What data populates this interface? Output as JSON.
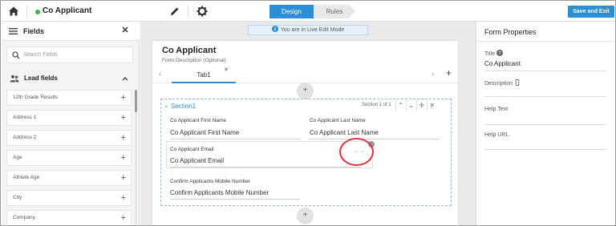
{
  "topbar": {
    "form_name": "Co Applicant",
    "tabs": [
      {
        "label": "Design",
        "active": true
      },
      {
        "label": "Rules",
        "active": false
      }
    ],
    "save_exit_label": "Save and Exit",
    "icons": [
      "home-icon",
      "pencil-icon",
      "gear-icon"
    ],
    "colors": {
      "accent": "#2b8fd6",
      "status": "#3db34a"
    }
  },
  "left_panel": {
    "title": "Fields",
    "search_placeholder": "Search Fields",
    "group_label": "Lead fields",
    "fields": [
      "12th Grade Results",
      "Address 1",
      "Address 2",
      "Age",
      "Athlete Age",
      "City",
      "Company"
    ]
  },
  "center": {
    "live_mode_text": "You are in Live Edit Mode",
    "form_title": "Co Applicant",
    "form_description": "Form Description (Optional)",
    "tab_label": "Tab1",
    "section": {
      "title": "Section1",
      "count_text": "Section 1 of 1",
      "fields": [
        {
          "label": "Co Applicant First Name",
          "value": "Co Applicant First Name"
        },
        {
          "label": "Co Applicant Last Name",
          "value": "Co Applicant Last Name"
        },
        {
          "label": "Co Applicant Email",
          "value": "Co Applicant Email"
        },
        {
          "label": "Confirm Applicants Mobile Number",
          "value": "Confirm Applicants Mobile Number"
        }
      ]
    },
    "highlight_color": "#d9363e"
  },
  "right_panel": {
    "title": "Form Properties",
    "properties": [
      {
        "label": "Title",
        "value": "Co Applicant"
      },
      {
        "label": "Description",
        "value": ""
      },
      {
        "label": "Help Text",
        "value": ""
      },
      {
        "label": "Help URL",
        "value": ""
      }
    ]
  }
}
